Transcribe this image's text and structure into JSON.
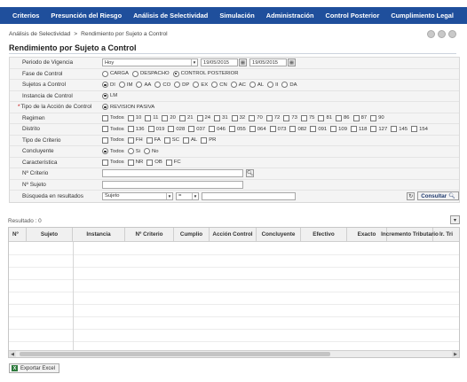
{
  "nav": [
    "Criterios",
    "Presunción del Riesgo",
    "Análisis de Selectividad",
    "Simulación",
    "Administración",
    "Control Posterior",
    "Cumplimiento Legal"
  ],
  "breadcrumb": [
    "Análisis de Selectividad",
    "Rendimiento por Sujeto a Control"
  ],
  "page_title": "Rendimiento por Sujeto a Control",
  "form": {
    "periodo": {
      "label": "Periodo de Vigencia",
      "select": "Hoy",
      "date_from": "19/05/2015",
      "date_to": "19/05/2015"
    },
    "fase": {
      "label": "Fase de Control",
      "options": [
        "CARGA",
        "DESPACHO",
        "CONTROL POSTERIOR"
      ],
      "selected": 2
    },
    "sujetos": {
      "label": "Sujetos a Control",
      "options": [
        "DI",
        "IM",
        "AA",
        "CO",
        "DP",
        "EX",
        "CN",
        "AC",
        "AL",
        "II",
        "DA"
      ],
      "selected": 0
    },
    "instancia": {
      "label": "Instancia de Control",
      "options": [
        "LM"
      ],
      "selected": 0
    },
    "tipo_accion": {
      "label": "Tipo de la Acción de Control",
      "options": [
        "REVISION PASIVA"
      ],
      "selected": 0
    },
    "regimen": {
      "label": "Regimen",
      "options": [
        "Todos",
        "10",
        "11",
        "20",
        "21",
        "24",
        "31",
        "32",
        "70",
        "72",
        "73",
        "75",
        "81",
        "86",
        "87",
        "90"
      ]
    },
    "distrito": {
      "label": "Distrito",
      "options": [
        "Todos",
        "136",
        "019",
        "028",
        "037",
        "046",
        "055",
        "064",
        "073",
        "082",
        "091",
        "109",
        "118",
        "127",
        "145",
        "154"
      ]
    },
    "tipo_criterio": {
      "label": "Tipo de Criterio",
      "options": [
        "Todos",
        "FH",
        "FA",
        "SC",
        "AL",
        "PR"
      ]
    },
    "concluyente": {
      "label": "Concluyente",
      "options": [
        "Todos",
        "Si",
        "No"
      ],
      "selected": 0
    },
    "caracteristica": {
      "label": "Característica",
      "options": [
        "Todos",
        "NR",
        "OB",
        "FC"
      ]
    },
    "n_criterio": {
      "label": "Nº Criterio",
      "value": ""
    },
    "n_sujeto": {
      "label": "Nº Sujeto",
      "value": ""
    },
    "busqueda": {
      "label": "Búsqueda en resultados",
      "field": "Sujeto",
      "operator": "=",
      "value": ""
    },
    "consultar_label": "Consultar"
  },
  "results": {
    "label": "Resultado : 0",
    "columns": [
      "Nº",
      "Sujeto",
      "Instancia",
      "Nº Criterio",
      "Cumplio",
      "Acción Control",
      "Concluyente",
      "Efectivo",
      "Exacto",
      "Incremento Tributario",
      "Ir. Tri"
    ],
    "rows": []
  },
  "export_label": "Exportar Excel",
  "colors": {
    "nav_bg": "#1f4f9c",
    "required": "#c00000"
  },
  "icons": {
    "calendar": "calendar-icon",
    "search": "search-icon",
    "refresh": "refresh-icon",
    "excel": "excel-icon"
  }
}
